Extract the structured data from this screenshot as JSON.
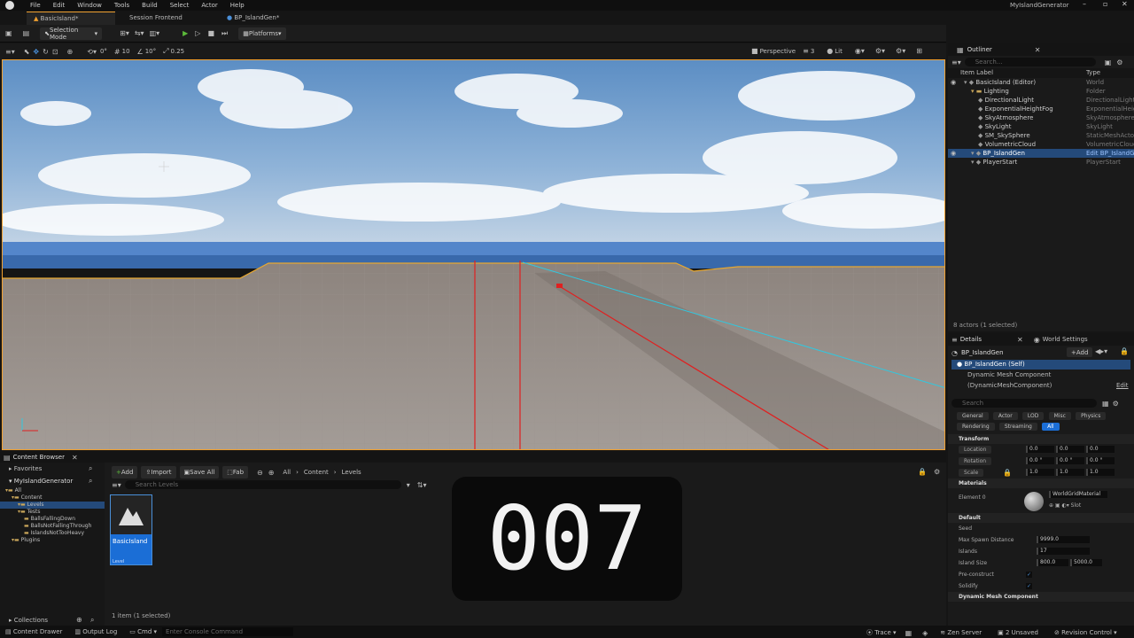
{
  "app": {
    "logo": "unreal-logo",
    "project": "MyIslandGenerator",
    "menu": [
      "File",
      "Edit",
      "Window",
      "Tools",
      "Build",
      "Select",
      "Actor",
      "Help"
    ]
  },
  "tabs": [
    "BasicIsland*",
    "Session Frontend",
    "BP_IslandGen*"
  ],
  "toolbar": {
    "selection_mode": "Selection Mode",
    "platforms": "Platforms"
  },
  "viewport_toolbar": {
    "snap_rot": "0°",
    "snap_grid": "10",
    "snap_angle": "10°",
    "snap_scale": "0.25",
    "view": "Perspective",
    "lit": "Lit",
    "speed": "3"
  },
  "outliner": {
    "title": "Outliner",
    "search_placeholder": "Search...",
    "col_label": "Item Label",
    "col_type": "Type",
    "rows": [
      {
        "label": "BasicIsland (Editor)",
        "type": "World",
        "indent": 0
      },
      {
        "label": "Lighting",
        "type": "Folder",
        "indent": 1
      },
      {
        "label": "DirectionalLight",
        "type": "DirectionalLight",
        "indent": 2
      },
      {
        "label": "ExponentialHeightFog",
        "type": "ExponentialHeightFog",
        "indent": 2
      },
      {
        "label": "SkyAtmosphere",
        "type": "SkyAtmosphere",
        "indent": 2
      },
      {
        "label": "SkyLight",
        "type": "SkyLight",
        "indent": 2
      },
      {
        "label": "SM_SkySphere",
        "type": "StaticMeshActor",
        "indent": 2
      },
      {
        "label": "VolumetricCloud",
        "type": "VolumetricCloud",
        "indent": 2
      },
      {
        "label": "BP_IslandGen",
        "type": "Edit BP_IslandGen",
        "indent": 1,
        "selected": true
      },
      {
        "label": "PlayerStart",
        "type": "PlayerStart",
        "indent": 1
      }
    ],
    "footer": "8 actors (1 selected)"
  },
  "details": {
    "tab1": "Details",
    "tab2": "World Settings",
    "actor": "BP_IslandGen",
    "add": "Add",
    "self": "BP_IslandGen (Self)",
    "component": "Dynamic Mesh Component (DynamicMeshComponent)",
    "edit": "Edit",
    "search_placeholder": "Search",
    "cats1": [
      "General",
      "Actor",
      "LOD",
      "Misc",
      "Physics"
    ],
    "cats2": [
      "Rendering",
      "Streaming",
      "All"
    ],
    "transform": "Transform",
    "location": "Location",
    "rotation": "Rotation",
    "scale": "Scale",
    "loc": [
      "0.0",
      "0.0",
      "0.0"
    ],
    "rot": [
      "0.0 °",
      "0.0 °",
      "0.0 °"
    ],
    "scl": [
      "1.0",
      "1.0",
      "1.0"
    ],
    "materials": "Materials",
    "element0": "Element 0",
    "material": "WorldGridMaterial",
    "slot": "Slot",
    "default": "Default",
    "seed": "Seed",
    "max_spawn": "Max Spawn Distance",
    "max_spawn_val": "9999.0",
    "islands": "Islands",
    "islands_val": "17",
    "island_size": "Island Size",
    "size1": "800.0",
    "size2": "5000.0",
    "preconstruct": "Pre-construct",
    "solidify": "Solidify",
    "dmc": "Dynamic Mesh Component"
  },
  "cb": {
    "title": "Content Browser",
    "add": "Add",
    "import": "Import",
    "save_all": "Save All",
    "fab": "Fab",
    "path": [
      "All",
      "Content",
      "Levels"
    ],
    "search_placeholder": "Search Levels",
    "favorites": "Favorites",
    "project": "MyIslandGenerator",
    "tree": [
      {
        "label": "All",
        "indent": 0
      },
      {
        "label": "Content",
        "indent": 1
      },
      {
        "label": "Levels",
        "indent": 2,
        "selected": true
      },
      {
        "label": "Tests",
        "indent": 2
      },
      {
        "label": "BallsFallingDown",
        "indent": 3
      },
      {
        "label": "BallsNotFallingThrough",
        "indent": 3
      },
      {
        "label": "IslandsNotTooHeavy",
        "indent": 3
      },
      {
        "label": "Plugins",
        "indent": 1
      }
    ],
    "collections": "Collections",
    "asset_name": "BasicIsland",
    "asset_type": "Level",
    "footer": "1 item (1 selected)"
  },
  "overlay": "007",
  "status": {
    "drawer": "Content Drawer",
    "output": "Output Log",
    "cmd": "Cmd",
    "console": "Enter Console Command",
    "trace": "Trace",
    "zen": "Zen Server",
    "unsaved": "2 Unsaved",
    "revision": "Revision Control"
  }
}
